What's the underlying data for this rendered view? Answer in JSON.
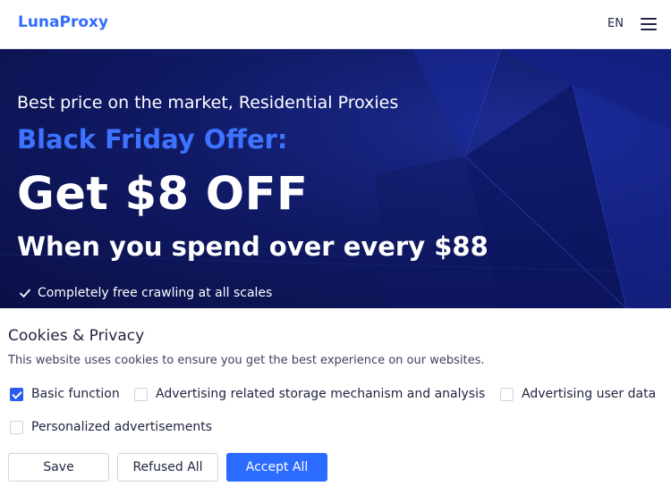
{
  "header": {
    "logo_text": "LunaProxy",
    "language": "EN",
    "menu_icon": "hamburger-menu-icon"
  },
  "hero": {
    "subtitle": "Best price on the market, Residential Proxies",
    "offer": "Black Friday Offer:",
    "headline": "Get $8 OFF",
    "spend": "When you spend over every $88",
    "feature": "Completely free crawling at all scales",
    "feature_icon": "check-icon",
    "colors": {
      "offer": "#3d73ff",
      "background": "#101a66"
    }
  },
  "cookie": {
    "title": "Cookies & Privacy",
    "description": "This website uses cookies to ensure you get the best experience on our websites.",
    "options": [
      {
        "label": "Basic function",
        "checked": true
      },
      {
        "label": "Advertising related storage mechanism and analysis",
        "checked": false
      },
      {
        "label": "Advertising user data",
        "checked": false
      },
      {
        "label": "Personalized advertisements",
        "checked": false
      }
    ],
    "buttons": {
      "save": "Save",
      "refuse": "Refused All",
      "accept": "Accept All"
    },
    "accent": "#2b6bff"
  }
}
